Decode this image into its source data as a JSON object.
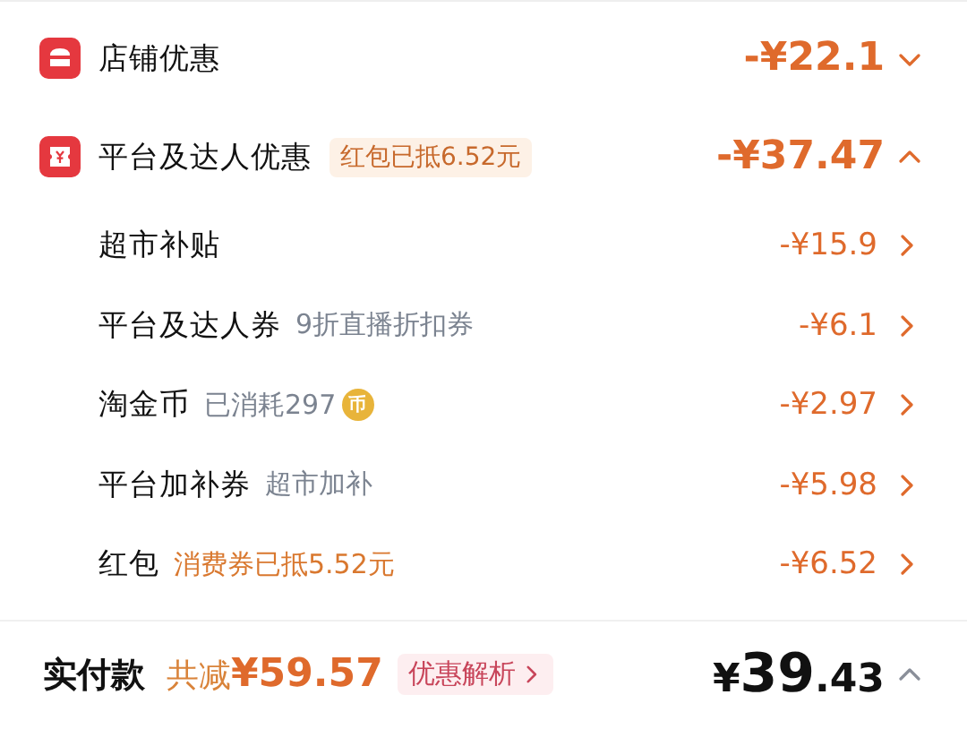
{
  "sections": [
    {
      "kind": "store",
      "title": "店铺优惠",
      "expanded": false,
      "amount": "-¥22.1"
    },
    {
      "kind": "coupon",
      "title": "平台及达人优惠",
      "badge": "红包已抵6.52元",
      "expanded": true,
      "amount": "-¥37.47",
      "children": [
        {
          "label": "超市补贴",
          "amount": "-¥15.9"
        },
        {
          "label": "平台及达人券",
          "note": "9折直播折扣券",
          "kind": "muted",
          "amount": "-¥6.1"
        },
        {
          "label": "淘金币",
          "note": "已消耗297",
          "kind": "muted",
          "coin": "币",
          "amount": "-¥2.97"
        },
        {
          "label": "平台加补券",
          "note": "超市加补",
          "kind": "muted",
          "amount": "-¥5.98"
        },
        {
          "label": "红包",
          "note": "消费券已抵5.52元",
          "kind": "highlight",
          "amount": "-¥6.52"
        }
      ]
    }
  ],
  "footer": {
    "label": "实付款",
    "savings_prefix": "共减",
    "savings": "¥59.57",
    "analysis_button": "优惠解析",
    "total_currency": "¥",
    "total_integer": "39",
    "total_decimal": ".43",
    "expanded": false
  }
}
